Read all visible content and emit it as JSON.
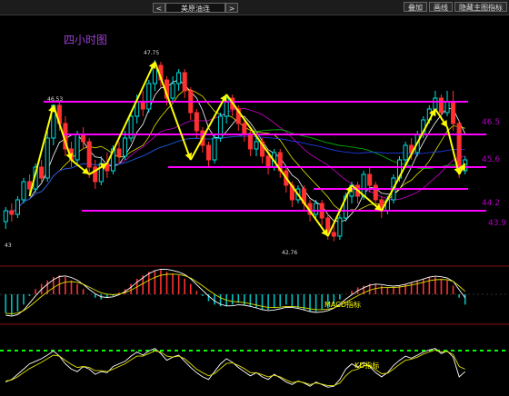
{
  "toolbar": {
    "prev": "<",
    "title": "美原油连",
    "next": ">",
    "buttons": [
      "叠加",
      "画线",
      "隐藏主图指标"
    ]
  },
  "chart_data": {
    "type": "candlestick",
    "title": "四小时图",
    "y_labels": [
      "46.5",
      "45.6",
      "44.2",
      "43.9"
    ],
    "annotations": [
      "47.75",
      "46.53",
      "43",
      "42.76"
    ],
    "horizontal_lines": [
      46.6,
      45.7,
      44.8,
      44.2,
      43.6
    ],
    "candles": [
      [
        43.3,
        43.6,
        43.1,
        43.7
      ],
      [
        43.6,
        43.5,
        43.3,
        43.8
      ],
      [
        43.5,
        43.9,
        43.4,
        44.0
      ],
      [
        43.9,
        44.4,
        43.8,
        44.5
      ],
      [
        44.4,
        44.2,
        44.0,
        44.6
      ],
      [
        44.2,
        44.8,
        44.1,
        44.9
      ],
      [
        44.8,
        44.5,
        44.4,
        45.0
      ],
      [
        44.5,
        45.6,
        44.4,
        45.8
      ],
      [
        45.6,
        46.5,
        45.4,
        46.53
      ],
      [
        46.5,
        46.0,
        45.8,
        46.6
      ],
      [
        46.0,
        45.3,
        45.1,
        46.2
      ],
      [
        45.3,
        45.0,
        44.8,
        45.5
      ],
      [
        45.0,
        45.7,
        44.9,
        45.8
      ],
      [
        45.7,
        45.5,
        45.3,
        45.9
      ],
      [
        45.5,
        44.8,
        44.5,
        45.6
      ],
      [
        44.8,
        44.4,
        44.2,
        45.0
      ],
      [
        44.4,
        44.9,
        44.3,
        45.1
      ],
      [
        44.9,
        44.7,
        44.5,
        45.2
      ],
      [
        44.7,
        45.3,
        44.6,
        45.4
      ],
      [
        45.3,
        45.1,
        44.9,
        45.5
      ],
      [
        45.1,
        45.6,
        45.0,
        45.8
      ],
      [
        45.6,
        46.2,
        45.5,
        46.3
      ],
      [
        46.2,
        46.6,
        46.0,
        46.8
      ],
      [
        46.6,
        46.4,
        46.2,
        46.9
      ],
      [
        46.4,
        47.1,
        46.3,
        47.2
      ],
      [
        47.1,
        47.6,
        46.9,
        47.75
      ],
      [
        47.6,
        47.2,
        47.0,
        47.7
      ],
      [
        47.2,
        46.7,
        46.5,
        47.3
      ],
      [
        46.7,
        47.1,
        46.6,
        47.3
      ],
      [
        47.1,
        47.4,
        46.9,
        47.5
      ],
      [
        47.4,
        46.9,
        46.7,
        47.5
      ],
      [
        46.9,
        46.3,
        46.1,
        47.0
      ],
      [
        46.3,
        45.8,
        45.6,
        46.4
      ],
      [
        45.8,
        45.4,
        45.2,
        45.9
      ],
      [
        45.4,
        45.0,
        44.8,
        45.5
      ],
      [
        45.0,
        45.6,
        44.9,
        45.7
      ],
      [
        45.6,
        46.2,
        45.5,
        46.3
      ],
      [
        46.2,
        46.7,
        46.0,
        46.8
      ],
      [
        46.7,
        46.4,
        46.2,
        46.8
      ],
      [
        46.4,
        46.0,
        45.8,
        46.5
      ],
      [
        46.0,
        45.7,
        45.5,
        46.1
      ],
      [
        45.7,
        45.3,
        45.1,
        45.8
      ],
      [
        45.3,
        45.5,
        45.1,
        45.7
      ],
      [
        45.5,
        45.1,
        44.9,
        45.6
      ],
      [
        45.1,
        44.8,
        44.6,
        45.2
      ],
      [
        44.8,
        45.2,
        44.7,
        45.3
      ],
      [
        45.2,
        44.7,
        44.5,
        45.3
      ],
      [
        44.7,
        44.3,
        44.1,
        44.8
      ],
      [
        44.3,
        43.9,
        43.7,
        44.4
      ],
      [
        43.9,
        44.2,
        43.8,
        44.3
      ],
      [
        44.2,
        43.8,
        43.6,
        44.3
      ],
      [
        43.8,
        43.5,
        43.3,
        43.9
      ],
      [
        43.5,
        43.8,
        43.4,
        43.9
      ],
      [
        43.8,
        43.4,
        43.2,
        43.9
      ],
      [
        43.4,
        43.0,
        42.8,
        43.5
      ],
      [
        43.0,
        42.9,
        42.76,
        43.2
      ],
      [
        42.9,
        43.4,
        42.8,
        43.5
      ],
      [
        43.4,
        44.0,
        43.3,
        44.1
      ],
      [
        44.0,
        44.3,
        43.8,
        44.4
      ],
      [
        44.3,
        44.0,
        43.8,
        44.4
      ],
      [
        44.0,
        44.6,
        43.9,
        44.7
      ],
      [
        44.6,
        44.3,
        44.1,
        44.8
      ],
      [
        44.3,
        43.9,
        43.7,
        44.4
      ],
      [
        43.9,
        43.6,
        43.4,
        44.0
      ],
      [
        43.6,
        43.9,
        43.5,
        44.0
      ],
      [
        43.9,
        44.5,
        43.8,
        44.6
      ],
      [
        44.5,
        45.0,
        44.4,
        45.1
      ],
      [
        45.0,
        45.4,
        44.9,
        45.5
      ],
      [
        45.4,
        45.2,
        45.0,
        45.6
      ],
      [
        45.2,
        45.7,
        45.1,
        45.8
      ],
      [
        45.7,
        46.1,
        45.6,
        46.2
      ],
      [
        46.1,
        46.4,
        46.0,
        46.5
      ],
      [
        46.4,
        46.7,
        46.2,
        46.9
      ],
      [
        46.7,
        46.3,
        46.1,
        46.8
      ],
      [
        46.3,
        46.6,
        46.2,
        46.9
      ],
      [
        46.6,
        46.0,
        45.8,
        46.9
      ],
      [
        46.0,
        44.7,
        44.5,
        46.1
      ],
      [
        44.7,
        45.0,
        44.6,
        45.1
      ]
    ],
    "macd_label": "MACD指标",
    "macd_hist": [
      -0.55,
      -0.6,
      -0.5,
      -0.3,
      -0.05,
      0.15,
      0.3,
      0.4,
      0.5,
      0.55,
      0.5,
      0.4,
      0.3,
      0.15,
      0.0,
      -0.1,
      -0.15,
      -0.1,
      -0.05,
      0.05,
      0.15,
      0.3,
      0.45,
      0.55,
      0.65,
      0.7,
      0.7,
      0.65,
      0.6,
      0.55,
      0.45,
      0.3,
      0.1,
      -0.05,
      -0.2,
      -0.3,
      -0.35,
      -0.35,
      -0.3,
      -0.25,
      -0.3,
      -0.35,
      -0.4,
      -0.45,
      -0.45,
      -0.4,
      -0.35,
      -0.3,
      -0.35,
      -0.4,
      -0.45,
      -0.5,
      -0.5,
      -0.45,
      -0.4,
      -0.3,
      -0.15,
      0.0,
      0.1,
      0.2,
      0.25,
      0.3,
      0.3,
      0.25,
      0.2,
      0.2,
      0.25,
      0.3,
      0.35,
      0.4,
      0.45,
      0.5,
      0.5,
      0.45,
      0.4,
      0.25,
      -0.1,
      -0.3
    ],
    "kd_label": "KD指标",
    "kd_k": [
      20,
      25,
      35,
      45,
      55,
      60,
      65,
      72,
      80,
      70,
      55,
      45,
      40,
      50,
      45,
      35,
      40,
      38,
      50,
      55,
      60,
      70,
      78,
      72,
      80,
      85,
      75,
      62,
      68,
      72,
      60,
      48,
      38,
      30,
      25,
      40,
      55,
      65,
      58,
      48,
      40,
      32,
      38,
      30,
      25,
      35,
      28,
      20,
      15,
      22,
      18,
      12,
      20,
      15,
      10,
      12,
      25,
      45,
      55,
      48,
      58,
      50,
      38,
      30,
      38,
      52,
      62,
      70,
      66,
      72,
      78,
      82,
      85,
      75,
      80,
      68,
      30,
      40
    ],
    "kd_d": [
      22,
      24,
      30,
      38,
      46,
      52,
      58,
      65,
      72,
      70,
      62,
      54,
      48,
      50,
      48,
      42,
      42,
      40,
      45,
      50,
      55,
      63,
      70,
      70,
      75,
      80,
      78,
      70,
      68,
      70,
      65,
      55,
      45,
      38,
      32,
      36,
      46,
      56,
      57,
      52,
      46,
      38,
      38,
      34,
      30,
      33,
      30,
      24,
      19,
      21,
      19,
      15,
      18,
      16,
      13,
      13,
      18,
      32,
      42,
      45,
      52,
      51,
      44,
      36,
      37,
      45,
      54,
      62,
      64,
      68,
      74,
      78,
      82,
      78,
      79,
      73,
      50,
      45
    ]
  }
}
